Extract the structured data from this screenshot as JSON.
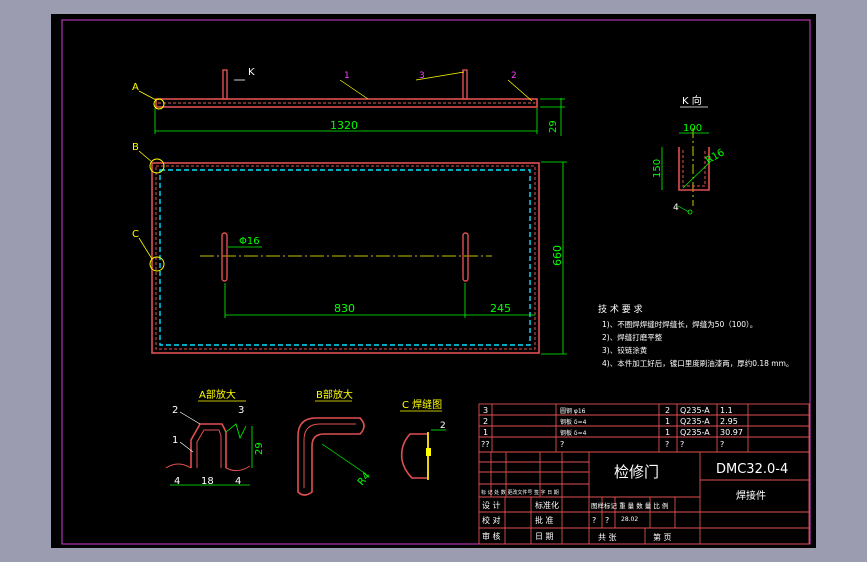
{
  "drawing": {
    "title": "检修门",
    "code": "DMC32.0-4",
    "subtitle": "焊接件",
    "scale_date": "28.02"
  },
  "front_view": {
    "dim_length": "1320",
    "dim_height": "29",
    "label_a": "A",
    "label_k": "K",
    "balloons": [
      "1",
      "3",
      "2"
    ]
  },
  "top_view": {
    "label_b": "B",
    "label_c": "C",
    "dim_hole": "Φ16",
    "dim_830": "830",
    "dim_245": "245",
    "dim_660": "660"
  },
  "k_view": {
    "title": "K 向",
    "dim_100": "100",
    "dim_150": "150",
    "dim_r16": "R16",
    "balloon": "4"
  },
  "tech_requirements": {
    "title": "技 术 要 求",
    "lines": [
      "1)、不圈焊焊缝时焊缝长，焊缝为50（100）。",
      "2)、焊缝打磨平整",
      "3)、铰链涂黄",
      "4)、本件加工好后，镀口里度刷油漆两，厚约0.18 mm。"
    ]
  },
  "details": {
    "a_title": "A部放大",
    "b_title": "B部放大",
    "c_title": "C 焊缝图",
    "a_dims": [
      "2",
      "3",
      "1",
      "29",
      "4",
      "18",
      "4"
    ],
    "b_dim": "R4",
    "c_dim": "2"
  },
  "bom": {
    "rows": [
      {
        "no": "3",
        "name": "圆钢 φ16",
        "qty": "2",
        "mat": "Q235-A",
        "wt": "1.1"
      },
      {
        "no": "2",
        "name": "钢板 δ=4",
        "qty": "1",
        "mat": "Q235-A",
        "wt": "2.95"
      },
      {
        "no": "1",
        "name": "钢板 δ=4",
        "qty": "1",
        "mat": "Q235-A",
        "wt": "30.97"
      },
      {
        "no": "??",
        "name": "?",
        "qty": "?",
        "mat": "?",
        "wt": "?"
      }
    ]
  },
  "title_block": {
    "header_row": "标 记 处 数 更改文件号 签 字 日 期",
    "design": "设 计",
    "standard": "标准化",
    "check": "校 对",
    "approve": "批 准",
    "review": "审 核",
    "date": "日 期",
    "stage_labels": "图样标记  重  量  数 量 比 例",
    "q1": "?",
    "q2": "?",
    "total_sheets": "共        张",
    "sheet": "第       页"
  }
}
